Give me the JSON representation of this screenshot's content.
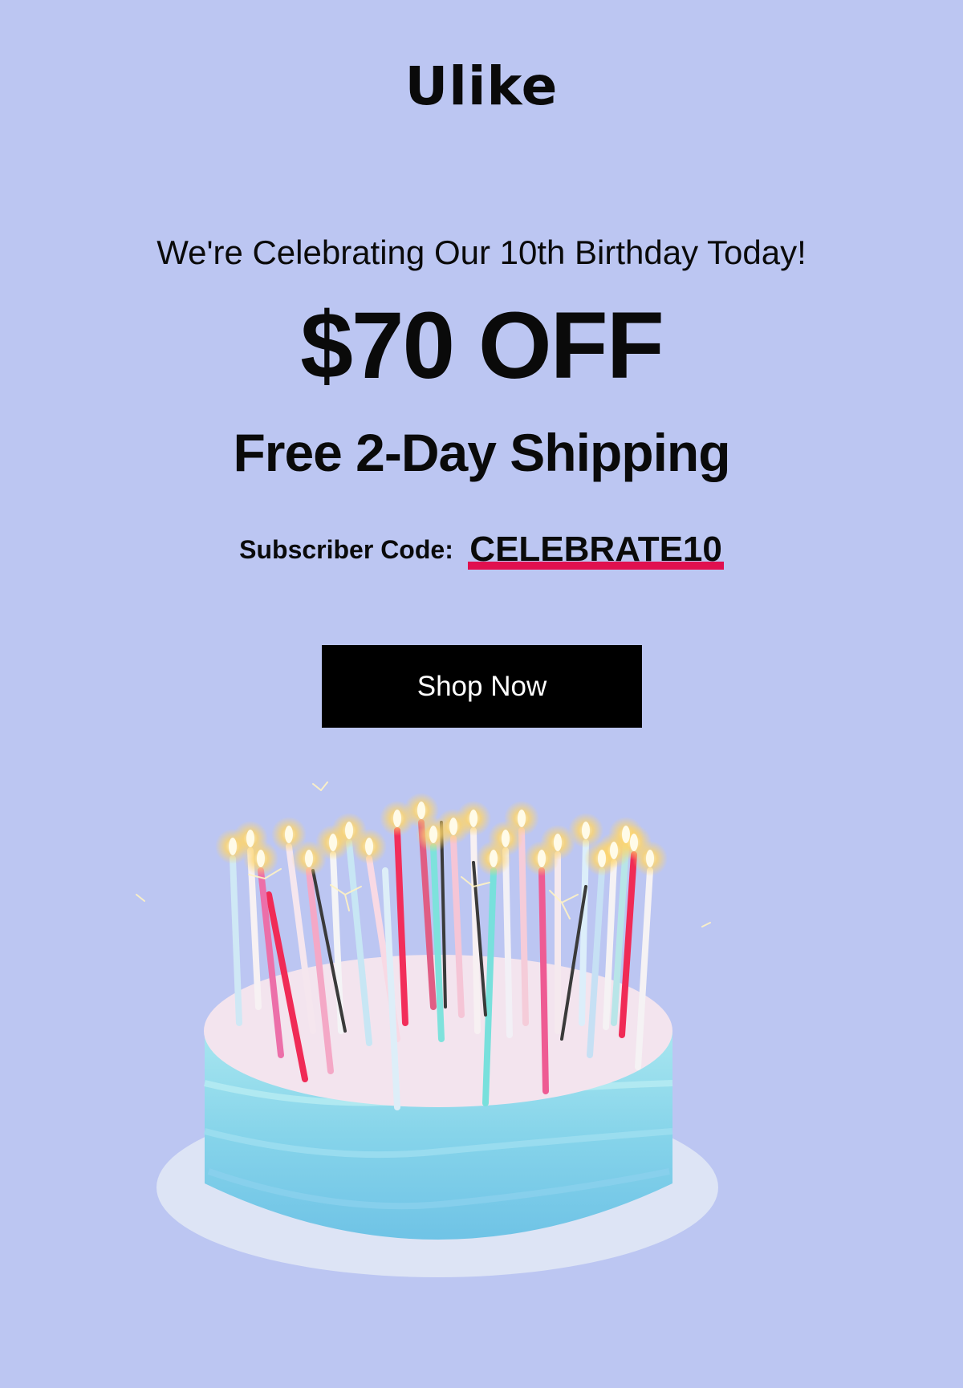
{
  "brand": {
    "logo_text": "Ulike"
  },
  "promo": {
    "headline": "We're Celebrating Our 10th Birthday Today!",
    "offer": "$70 OFF",
    "shipping": "Free 2-Day Shipping",
    "code_label": "Subscriber Code:",
    "code_value": "CELEBRATE10",
    "code_underline_color": "#e0104f"
  },
  "cta": {
    "label": "Shop Now"
  },
  "hero_image": {
    "subject": "birthday-cake-with-candles"
  },
  "colors": {
    "background": "#bcc6f2",
    "button": "#000000",
    "button_text": "#ffffff",
    "cake_frosting": "#8fdcec",
    "cake_top": "#f3e4ee"
  }
}
